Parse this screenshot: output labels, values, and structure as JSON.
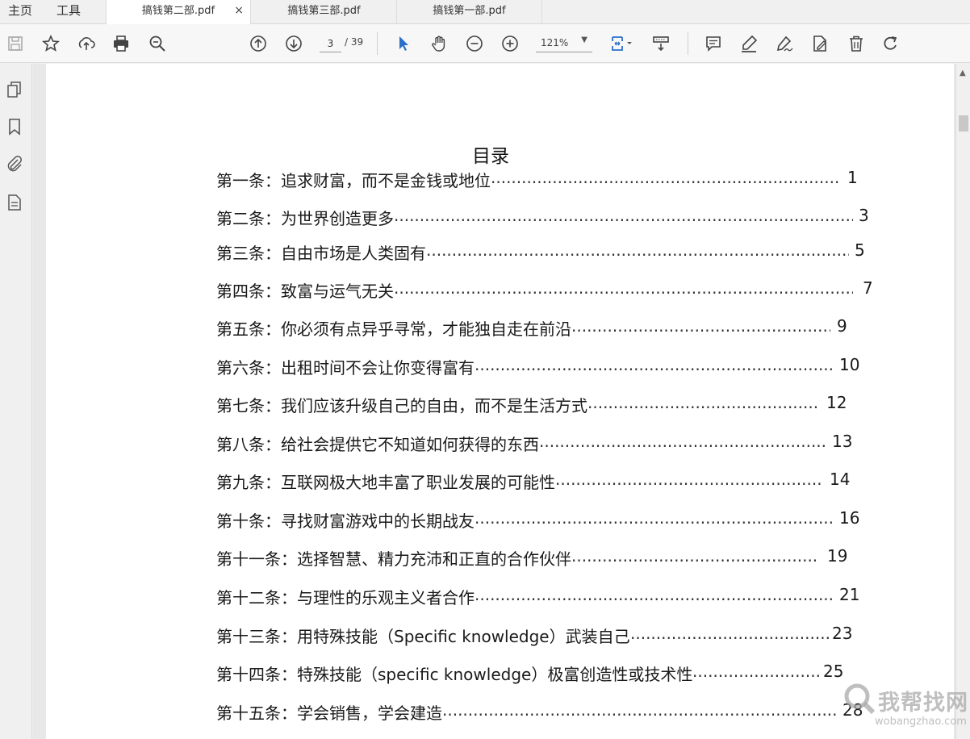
{
  "nav_tabs": {
    "home": "主页",
    "tools": "工具"
  },
  "doc_tabs": [
    {
      "label": "搞钱第二部.pdf",
      "active": true,
      "close": "×"
    },
    {
      "label": "搞钱第三部.pdf",
      "active": false
    },
    {
      "label": "搞钱第一部.pdf",
      "active": false
    }
  ],
  "toolbar": {
    "current_page": "3",
    "total_pages": "/ 39",
    "zoom": "121%",
    "zoom_arrow": "▼",
    "icons": [
      "save-icon",
      "star-icon",
      "upload-icon",
      "print-icon",
      "zoom-search-icon",
      "page-up-icon",
      "page-down-icon",
      "select-cursor-icon",
      "hand-icon",
      "zoom-out-icon",
      "zoom-in-icon",
      "fit-page-icon",
      "scroll-mode-icon",
      "comment-icon",
      "highlight-icon",
      "sign-icon",
      "edit-icon",
      "delete-icon",
      "rotate-icon"
    ]
  },
  "left_rail": {
    "icons": [
      "page-thumbnails-icon",
      "bookmark-icon",
      "attachment-icon",
      "document-properties-icon"
    ],
    "collapse": "◀"
  },
  "document": {
    "title": "目录",
    "toc": [
      {
        "text": "第一条：追求财富，而不是金钱或地位",
        "page": "1"
      },
      {
        "text": "第二条：为世界创造更多",
        "page": "3"
      },
      {
        "text": "第三条：自由市场是人类固有",
        "page": "5"
      },
      {
        "text": "第四条：致富与运气无关",
        "page": "7"
      },
      {
        "text": "第五条：你必须有点异乎寻常，才能独自走在前沿",
        "page": "9"
      },
      {
        "text": "第六条：出租时间不会让你变得富有",
        "page": "10"
      },
      {
        "text": "第七条：我们应该升级自己的自由，而不是生活方式",
        "page": "12"
      },
      {
        "text": "第八条：给社会提供它不知道如何获得的东西",
        "page": "13"
      },
      {
        "text": "第九条：互联网极大地丰富了职业发展的可能性",
        "page": "14"
      },
      {
        "text": "第十条：寻找财富游戏中的长期战友",
        "page": "16"
      },
      {
        "text": "第十一条：选择智慧、精力充沛和正直的合作伙伴",
        "page": "19"
      },
      {
        "text": "第十二条：与理性的乐观主义者合作",
        "page": "21"
      },
      {
        "text": "第十三条：用特殊技能（Specific knowledge）武装自己",
        "page": "23"
      },
      {
        "text": "第十四条：特殊技能（specific knowledge）极富创造性或技术性",
        "page": "25"
      },
      {
        "text": "第十五条：学会销售，学会建造",
        "page": "28"
      }
    ]
  },
  "scrollbar": {
    "up": "▲"
  },
  "watermark": {
    "cn": "我帮找网",
    "en": "wobangzhao.com"
  }
}
